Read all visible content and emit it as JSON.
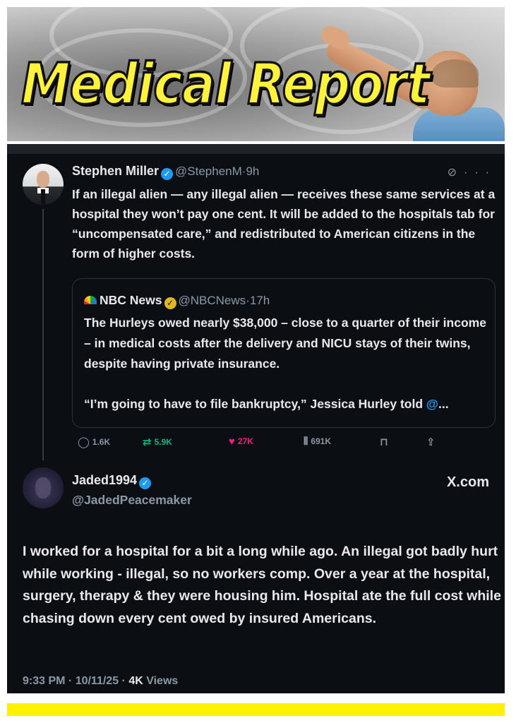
{
  "banner": {
    "title": "Medical Report"
  },
  "main_post": {
    "author_name": "Stephen Miller",
    "handle": "@StephenM",
    "separator": "·",
    "time": "9h",
    "body": "If an illegal alien — any illegal alien — receives these same services at a hospital they won’t pay one cent. It will be added to the hospitals tab for “uncompensated care,” and redistributed to American citizens in the form of higher costs."
  },
  "quoted_post": {
    "author_name": "NBC News",
    "handle": "@NBCNews",
    "time": "17h",
    "paragraph1": "The Hurleys owed nearly $38,000 – close to a quarter of their income – in medical costs after the delivery and NICU stays of their twins, despite having private insurance.",
    "paragraph2_text": "“I’m going to have to file bankruptcy,” Jessica Hurley told ",
    "paragraph2_mention": "@",
    "paragraph2_ellipsis": "..."
  },
  "actions": {
    "replies": "1.6K",
    "reposts": "5.9K",
    "likes": "27K",
    "views": "691K",
    "colors": {
      "reposts": "#00ba7c",
      "likes": "#f91880",
      "default": "#8b98a5"
    }
  },
  "reply_post": {
    "author_name": "Jaded1994",
    "handle": "@JadedPeacemaker",
    "site": "X.com",
    "body": "I worked for a hospital for a bit a long while ago. An illegal got badly hurt while working - illegal, so no workers comp. Over a year at the hospital, surgery, therapy & they were housing him. Hospital ate the full cost while chasing down every cent owed by insured Americans.",
    "timestamp": "9:33 PM · 10/11/25 · ",
    "views_count": "4K",
    "views_label": " Views"
  },
  "icons": {
    "verified": "verified-badge-icon",
    "grok": "grok-icon",
    "more": "more-dots-icon",
    "reply": "reply-icon",
    "repost": "repost-icon",
    "like": "heart-icon",
    "views": "views-icon",
    "bookmark": "bookmark-icon",
    "share": "share-icon"
  }
}
